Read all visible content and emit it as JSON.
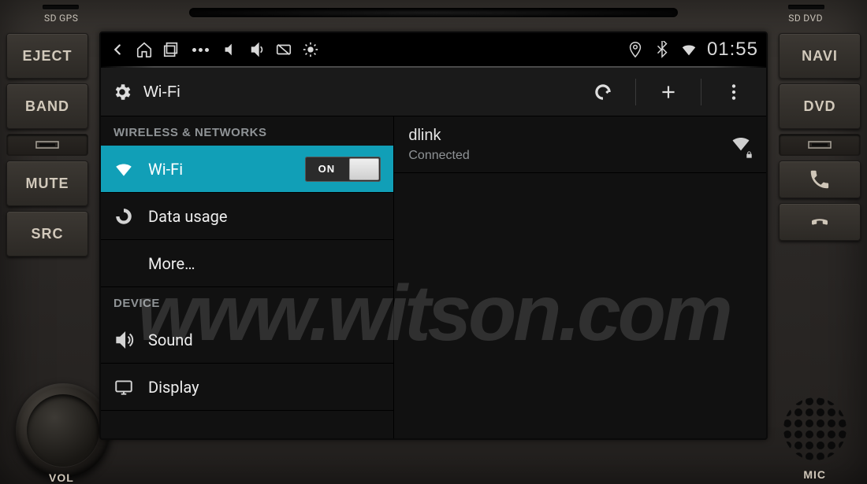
{
  "hardware": {
    "sd_left": "GPS",
    "sd_right": "DVD",
    "sd_mark": "SD",
    "left_buttons": [
      "EJECT",
      "BAND",
      "MUTE",
      "SRC"
    ],
    "right_buttons": [
      "NAVI",
      "DVD"
    ],
    "vol_label": "VOL",
    "mic_label": "MIC"
  },
  "statusbar": {
    "time": "01:55"
  },
  "actionbar": {
    "title": "Wi-Fi"
  },
  "settings": {
    "section_wireless": "WIRELESS & NETWORKS",
    "wifi_label": "Wi-Fi",
    "wifi_switch": "ON",
    "data_usage": "Data usage",
    "more": "More…",
    "section_device": "DEVICE",
    "sound": "Sound",
    "display": "Display"
  },
  "networks": {
    "items": [
      {
        "ssid": "dlink",
        "status": "Connected"
      }
    ]
  },
  "watermark": "www.witson.com"
}
